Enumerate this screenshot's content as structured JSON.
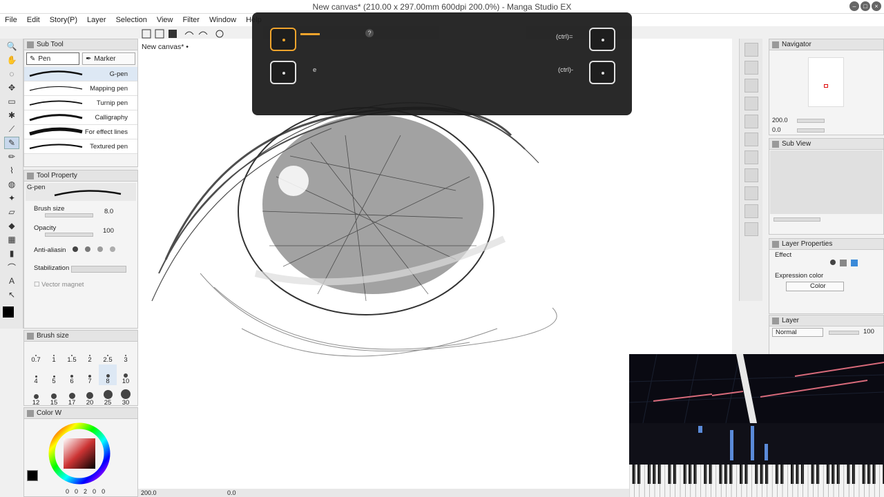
{
  "window": {
    "title": "New canvas* (210.00 x 297.00mm 600dpi 200.0%)  - Manga Studio EX"
  },
  "menu": [
    "File",
    "Edit",
    "Story(P)",
    "Layer",
    "Selection",
    "View",
    "Filter",
    "Window",
    "Help"
  ],
  "canvas_tab": "New canvas*",
  "sub_tool": {
    "title": "Sub Tool",
    "tabs": [
      "Pen",
      "Marker"
    ],
    "brushes": [
      "G-pen",
      "Mapping pen",
      "Turnip pen",
      "Calligraphy",
      "For effect lines",
      "Textured pen"
    ],
    "selected": "G-pen"
  },
  "tool_property": {
    "title": "Tool Property",
    "brush_name": "G-pen",
    "brush_size_label": "Brush size",
    "brush_size_value": "8.0",
    "opacity_label": "Opacity",
    "opacity_value": "100",
    "anti_alias_label": "Anti-aliasin",
    "stabilization_label": "Stabilization",
    "vector_magnet_label": "Vector magnet"
  },
  "brush_size_panel": {
    "title": "Brush size",
    "sizes": [
      "0.7",
      "1",
      "1.5",
      "2",
      "2.5",
      "3",
      "4",
      "5",
      "6",
      "7",
      "8",
      "10",
      "12",
      "15",
      "17",
      "20",
      "25",
      "30"
    ],
    "selected": "8"
  },
  "color_wheel": {
    "title": "Color W",
    "readout": [
      "0",
      "0",
      "2",
      "0",
      "0"
    ]
  },
  "shortcut_popup": {
    "row1_right": "(ctrl)=",
    "row2_left": "e",
    "row2_right": "(ctrl)-"
  },
  "navigator": {
    "title": "Navigator",
    "zoom": "200.0",
    "angle": "0.0"
  },
  "sub_view": {
    "title": "Sub View"
  },
  "layer_properties": {
    "title": "Layer Properties",
    "effect_label": "Effect",
    "expression_color_label": "Expression color",
    "color_value": "Color"
  },
  "layer": {
    "title": "Layer",
    "blend_mode": "Normal",
    "opacity": "100"
  },
  "status": {
    "zoom": "200.0",
    "angle": "0.0"
  },
  "colors": {
    "popup_highlight": "#f0a020",
    "piano_note": "#d86a7a",
    "selection": "#dde8f4"
  }
}
